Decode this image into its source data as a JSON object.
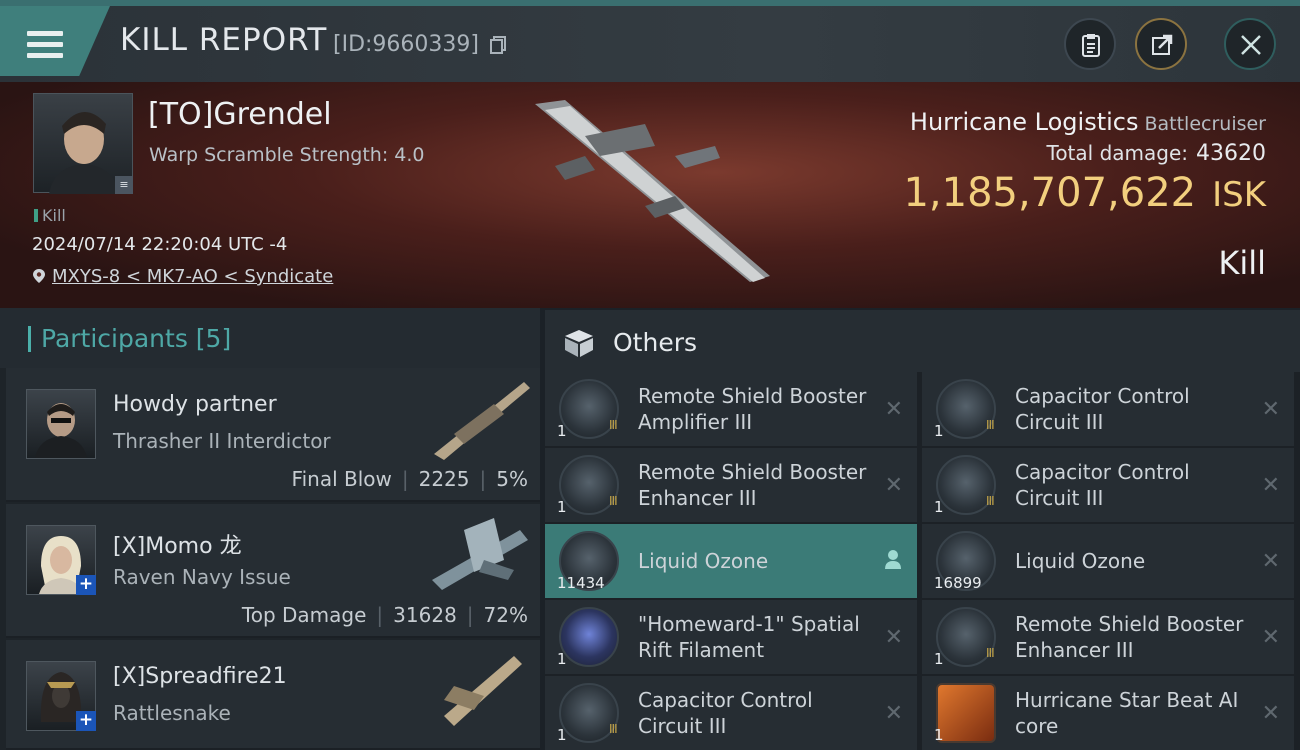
{
  "header": {
    "title": "KILL REPORT",
    "report_id": "[ID:9660339]"
  },
  "victim": {
    "name": "[TO]Grendel",
    "warp_scramble": "Warp Scramble Strength: 4.0",
    "kill_tag": "Kill",
    "datetime": "2024/07/14 22:20:04 UTC -4",
    "location": "MXYS-8 < MK7-AO < Syndicate"
  },
  "ship": {
    "name": "Hurricane Logistics",
    "class": "Battlecruiser",
    "total_damage_label": "Total damage:",
    "total_damage": "43620",
    "isk_value": "1,185,707,622",
    "isk_unit": "ISK",
    "result": "Kill"
  },
  "participants": {
    "title": "Participants [5]",
    "rows": [
      {
        "name": "Howdy partner",
        "ship": "Thrasher II Interdictor",
        "role": "Final Blow",
        "damage": "2225",
        "percent": "5%"
      },
      {
        "name": "[X]Momo 龙",
        "ship": "Raven Navy Issue",
        "role": "Top Damage",
        "damage": "31628",
        "percent": "72%"
      },
      {
        "name": "[X]Spreadfire21",
        "ship": "Rattlesnake"
      }
    ]
  },
  "others": {
    "title": "Others",
    "items": [
      {
        "name": "Remote Shield Booster Amplifier III",
        "qty": "1",
        "meta": "III"
      },
      {
        "name": "Capacitor Control Circuit III",
        "qty": "1",
        "meta": "III"
      },
      {
        "name": "Remote Shield Booster Enhancer III",
        "qty": "1",
        "meta": "III"
      },
      {
        "name": "Capacitor Control Circuit III",
        "qty": "1",
        "meta": "III"
      },
      {
        "name": "Liquid Ozone",
        "qty": "11434"
      },
      {
        "name": "Liquid Ozone",
        "qty": "16899"
      },
      {
        "name": "\"Homeward-1\" Spatial Rift Filament",
        "qty": "1"
      },
      {
        "name": "Remote Shield Booster Enhancer III",
        "qty": "1",
        "meta": "III"
      },
      {
        "name": "Capacitor Control Circuit III",
        "qty": "1",
        "meta": "III"
      },
      {
        "name": "Hurricane Star Beat AI core",
        "qty": "1"
      }
    ]
  },
  "icons": {
    "menu": "hamburger-menu-icon",
    "copy": "copy-icon",
    "clipboard": "clipboard-icon",
    "share": "share-icon",
    "close": "close-icon",
    "location": "map-pin-icon",
    "others": "cube-icon",
    "remove": "remove-x-icon",
    "owner": "person-icon"
  },
  "colors": {
    "accent": "#3f7f7c",
    "isk": "#f2cf7e",
    "participants_title": "#4ea8a6",
    "selected_row": "#3b7b77"
  }
}
